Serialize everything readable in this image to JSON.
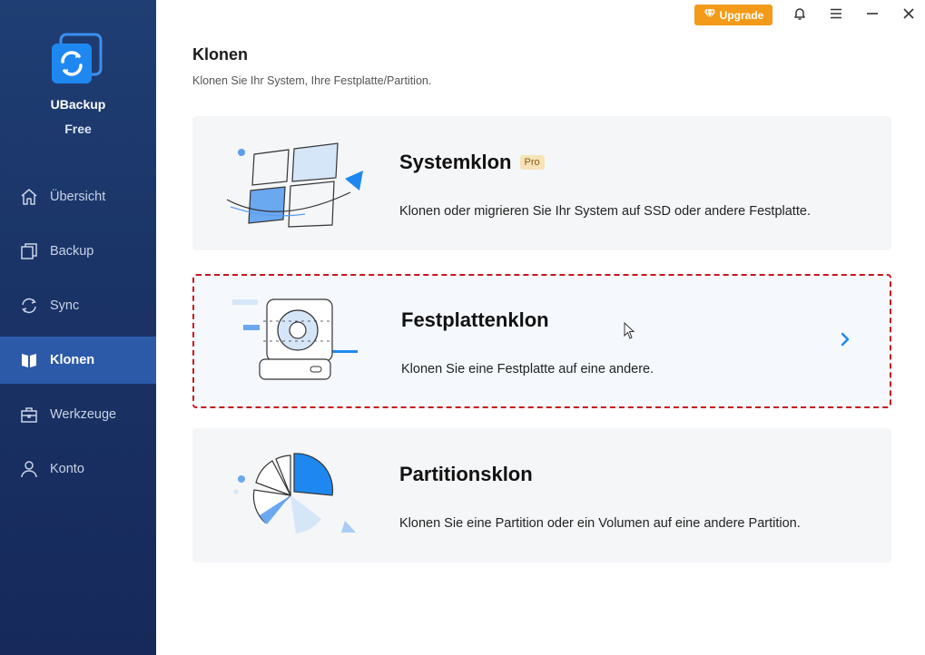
{
  "app": {
    "name": "UBackup",
    "edition": "Free"
  },
  "sidebar": {
    "items": [
      {
        "label": "Übersicht",
        "icon": "home-icon"
      },
      {
        "label": "Backup",
        "icon": "backup-icon"
      },
      {
        "label": "Sync",
        "icon": "sync-icon"
      },
      {
        "label": "Klonen",
        "icon": "clone-icon",
        "active": true
      },
      {
        "label": "Werkzeuge",
        "icon": "toolbox-icon"
      },
      {
        "label": "Konto",
        "icon": "user-icon"
      }
    ]
  },
  "topbar": {
    "upgrade_label": "Upgrade",
    "upgrade_icon": "diamond-icon",
    "accent": "#f39a18"
  },
  "header": {
    "title": "Klonen",
    "subtitle": "Klonen Sie Ihr System, Ihre Festplatte/Partition."
  },
  "cards": [
    {
      "title": "Systemklon",
      "badge": "Pro",
      "desc": "Klonen oder migrieren Sie Ihr System auf SSD oder andere Festplatte."
    },
    {
      "title": "Festplattenklon",
      "desc": "Klonen Sie eine Festplatte auf eine andere.",
      "selected": true
    },
    {
      "title": "Partitionsklon",
      "desc": "Klonen Sie eine Partition oder ein Volumen auf eine andere Partition."
    }
  ],
  "colors": {
    "sidebar": "#1a3366",
    "active_nav": "#2c5aa8",
    "brand_blue": "#1e88f0",
    "selection_border": "#c8161d"
  }
}
